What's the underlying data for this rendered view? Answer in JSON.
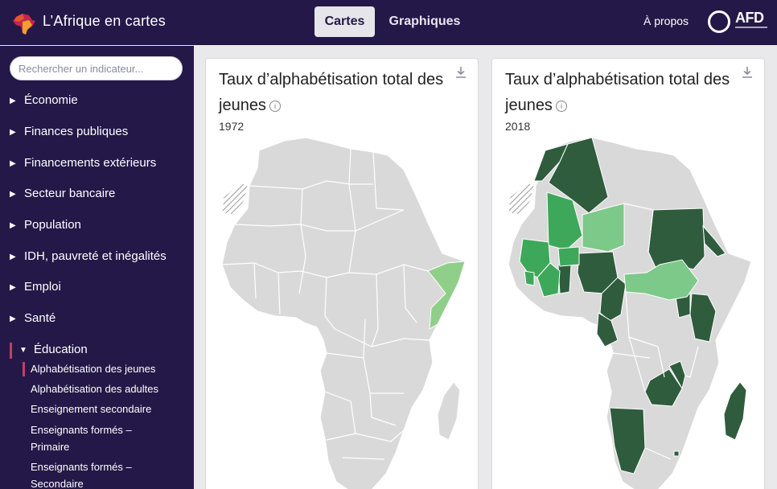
{
  "header": {
    "brand": "L’Afrique en cartes",
    "tabs": [
      {
        "label": "Cartes",
        "active": true
      },
      {
        "label": "Graphiques",
        "active": false
      }
    ],
    "about": "À propos",
    "partner_logo": "AFD"
  },
  "sidebar": {
    "search_placeholder": "Rechercher un indicateur...",
    "categories": [
      {
        "label": "Économie",
        "expanded": false
      },
      {
        "label": "Finances publiques",
        "expanded": false
      },
      {
        "label": "Financements extérieurs",
        "expanded": false
      },
      {
        "label": "Secteur bancaire",
        "expanded": false
      },
      {
        "label": "Population",
        "expanded": false
      },
      {
        "label": "IDH, pauvreté et inégalités",
        "expanded": false
      },
      {
        "label": "Emploi",
        "expanded": false
      },
      {
        "label": "Santé",
        "expanded": false
      },
      {
        "label": "Éducation",
        "expanded": true
      }
    ],
    "education_items": [
      {
        "label": "Alphabétisation des jeunes",
        "active": true
      },
      {
        "label": "Alphabétisation des adultes",
        "active": false
      },
      {
        "label": "Enseignement secondaire",
        "active": false
      },
      {
        "label": "Enseignants formés –",
        "label2": "Primaire",
        "active": false
      },
      {
        "label": "Enseignants formés –",
        "label2": "Secondaire",
        "active": false
      }
    ]
  },
  "maps": [
    {
      "title": "Taux d’alphabétisation total des jeunes",
      "year": "1972"
    },
    {
      "title": "Taux d’alphabétisation total des jeunes",
      "year": "2018"
    }
  ],
  "colors": {
    "header_bg": "#241848",
    "no_data": "#d8d8d8",
    "green_light": "#7cc98a",
    "green_mid": "#3da85a",
    "green_dark": "#2f5c3d",
    "accent": "#c33e63"
  }
}
